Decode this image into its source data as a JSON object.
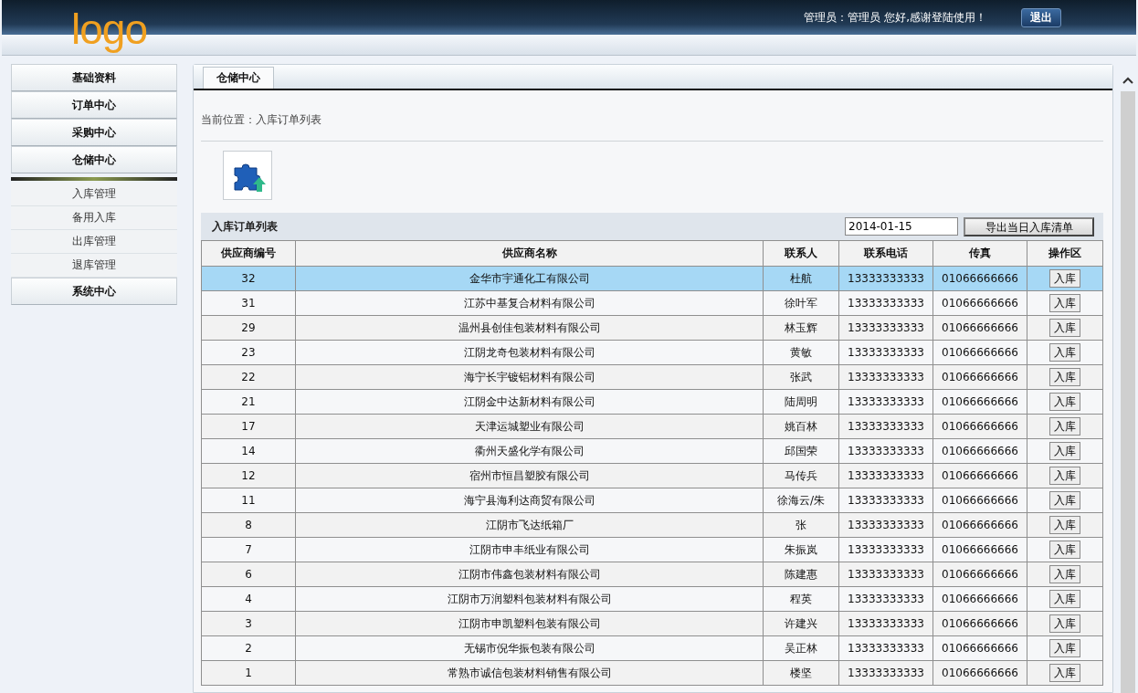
{
  "header": {
    "logo": "logo",
    "greeting": "管理员：管理员  您好,感谢登陆使用！",
    "logout": "退出"
  },
  "sidebar": {
    "items": [
      {
        "label": "基础资料"
      },
      {
        "label": "订单中心"
      },
      {
        "label": "采购中心"
      },
      {
        "label": "仓储中心",
        "children": [
          {
            "label": "入库管理"
          },
          {
            "label": "备用入库"
          },
          {
            "label": "出库管理"
          },
          {
            "label": "退库管理"
          }
        ]
      },
      {
        "label": "系统中心"
      }
    ]
  },
  "tabs": [
    {
      "label": "仓储中心",
      "selected": true
    }
  ],
  "breadcrumb": "当前位置：入库订单列表",
  "list": {
    "title": "入库订单列表",
    "date": {
      "value": "2014-01-15"
    },
    "export_button": "导出当日入库清单"
  },
  "table": {
    "columns": [
      "供应商编号",
      "供应商名称",
      "联系人",
      "联系电话",
      "传真",
      "操作区"
    ],
    "rows": [
      {
        "id": "32",
        "name": "金华市宇通化工有限公司",
        "contact": "杜航",
        "phone": "13333333333",
        "fax": "01066666666",
        "action": "入库",
        "selected": true
      },
      {
        "id": "31",
        "name": "江苏中基复合材料有限公司",
        "contact": "徐叶军",
        "phone": "13333333333",
        "fax": "01066666666",
        "action": "入库",
        "selected": false
      },
      {
        "id": "29",
        "name": "温州县创佳包装材料有限公司",
        "contact": "林玉辉",
        "phone": "13333333333",
        "fax": "01066666666",
        "action": "入库",
        "selected": false
      },
      {
        "id": "23",
        "name": "江阴龙奇包装材料有限公司",
        "contact": "黄敏",
        "phone": "13333333333",
        "fax": "01066666666",
        "action": "入库",
        "selected": false
      },
      {
        "id": "22",
        "name": "海宁长宇镀铝材料有限公司",
        "contact": "张武",
        "phone": "13333333333",
        "fax": "01066666666",
        "action": "入库",
        "selected": false
      },
      {
        "id": "21",
        "name": "江阴金中达新材料有限公司",
        "contact": "陆周明",
        "phone": "13333333333",
        "fax": "01066666666",
        "action": "入库",
        "selected": false
      },
      {
        "id": "17",
        "name": "天津运城塑业有限公司",
        "contact": "姚百林",
        "phone": "13333333333",
        "fax": "01066666666",
        "action": "入库",
        "selected": false
      },
      {
        "id": "14",
        "name": "衢州天盛化学有限公司",
        "contact": "邱国荣",
        "phone": "13333333333",
        "fax": "01066666666",
        "action": "入库",
        "selected": false
      },
      {
        "id": "12",
        "name": "宿州市恒昌塑胶有限公司",
        "contact": "马传兵",
        "phone": "13333333333",
        "fax": "01066666666",
        "action": "入库",
        "selected": false
      },
      {
        "id": "11",
        "name": "海宁县海利达商贸有限公司",
        "contact": "徐海云/朱",
        "phone": "13333333333",
        "fax": "01066666666",
        "action": "入库",
        "selected": false
      },
      {
        "id": "8",
        "name": "江阴市飞达纸箱厂",
        "contact": "张",
        "phone": "13333333333",
        "fax": "01066666666",
        "action": "入库",
        "selected": false
      },
      {
        "id": "7",
        "name": "江阴市申丰纸业有限公司",
        "contact": "朱振岚",
        "phone": "13333333333",
        "fax": "01066666666",
        "action": "入库",
        "selected": false
      },
      {
        "id": "6",
        "name": "江阴市伟鑫包装材料有限公司",
        "contact": "陈建惠",
        "phone": "13333333333",
        "fax": "01066666666",
        "action": "入库",
        "selected": false
      },
      {
        "id": "4",
        "name": "江阴市万润塑料包装材料有限公司",
        "contact": "程英",
        "phone": "13333333333",
        "fax": "01066666666",
        "action": "入库",
        "selected": false
      },
      {
        "id": "3",
        "name": "江阴市申凯塑料包装有限公司",
        "contact": "许建兴",
        "phone": "13333333333",
        "fax": "01066666666",
        "action": "入库",
        "selected": false
      },
      {
        "id": "2",
        "name": "无锡市倪华振包装有限公司",
        "contact": "吴正林",
        "phone": "13333333333",
        "fax": "01066666666",
        "action": "入库",
        "selected": false
      },
      {
        "id": "1",
        "name": "常熟市诚信包装材料销售有限公司",
        "contact": "楼坚",
        "phone": "13333333333",
        "fax": "01066666666",
        "action": "入库",
        "selected": false
      }
    ]
  }
}
